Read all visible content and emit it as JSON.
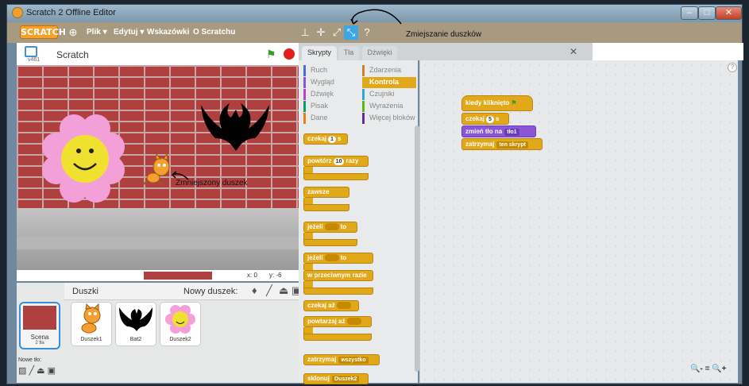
{
  "window": {
    "title": "Scratch 2 Offline Editor",
    "controls": {
      "minimize": "–",
      "maximize": "□",
      "close": "✕"
    }
  },
  "menubar": {
    "logo": "SCRATCH",
    "items": [
      "Plik ▾",
      "Edytuj ▾",
      "Wskazówki",
      "O Scratchu"
    ],
    "annotation": "Zmiejszanie duszków"
  },
  "stage": {
    "title": "Scratch",
    "version": "v461",
    "sprite_annotation": "Zmniejszony duszek",
    "coords": {
      "x_label": "x: 0",
      "y_label": "y: -6"
    }
  },
  "sprites_panel": {
    "title": "Duszki",
    "new_sprite_label": "Nowy duszek:",
    "scene": {
      "label": "Scena",
      "count": "2 tła"
    },
    "new_backdrop_label": "Nowe tło:",
    "sprites": [
      {
        "name": "Duszek1",
        "icon": "cat-icon"
      },
      {
        "name": "Bat2",
        "icon": "bat-icon"
      },
      {
        "name": "Duszek2",
        "icon": "flower-icon"
      }
    ]
  },
  "tabs": {
    "scripts": "Skrypty",
    "backdrops": "Tła",
    "sounds": "Dźwięki",
    "close": "✕"
  },
  "categories": [
    {
      "label": "Ruch",
      "color": "#4a6cd4"
    },
    {
      "label": "Zdarzenia",
      "color": "#c88330"
    },
    {
      "label": "Wygląd",
      "color": "#8a55d7"
    },
    {
      "label": "Kontrola",
      "color": "#e1a91a"
    },
    {
      "label": "Dźwięk",
      "color": "#bb42c3"
    },
    {
      "label": "Czujniki",
      "color": "#2ca5e2"
    },
    {
      "label": "Pisak",
      "color": "#0e9a6c"
    },
    {
      "label": "Wyrażenia",
      "color": "#5cb712"
    },
    {
      "label": "Dane",
      "color": "#ee7d16"
    },
    {
      "label": "Więcej bloków",
      "color": "#632d99"
    }
  ],
  "palette_blocks": {
    "wait": {
      "text": "czekaj",
      "value": "1",
      "suffix": "s"
    },
    "repeat": {
      "text": "powtórz",
      "value": "10",
      "suffix": "razy"
    },
    "forever": {
      "text": "zawsze"
    },
    "if": {
      "text": "jeżeli",
      "suffix": "to"
    },
    "if_else": {
      "text": "jeżeli",
      "suffix": "to",
      "else": "w przeciwnym razie"
    },
    "wait_until": {
      "text": "czekaj aż"
    },
    "repeat_until": {
      "text": "powtarzaj aż"
    },
    "stop": {
      "text": "zatrzymaj",
      "option": "wszystko"
    },
    "clone": {
      "text": "sklonuj",
      "option": "Duszek2"
    }
  },
  "script": {
    "hat": "kiedy kliknięto",
    "wait": {
      "text": "czekaj",
      "value": "5",
      "suffix": "s"
    },
    "switch_bg": {
      "text": "zmień tło na",
      "option": "tło1"
    },
    "stop": {
      "text": "zatrzymaj",
      "option": "ten skrypt"
    }
  },
  "zoom": {
    "out": "🔍-",
    "reset": "=",
    "in": "🔍+"
  }
}
